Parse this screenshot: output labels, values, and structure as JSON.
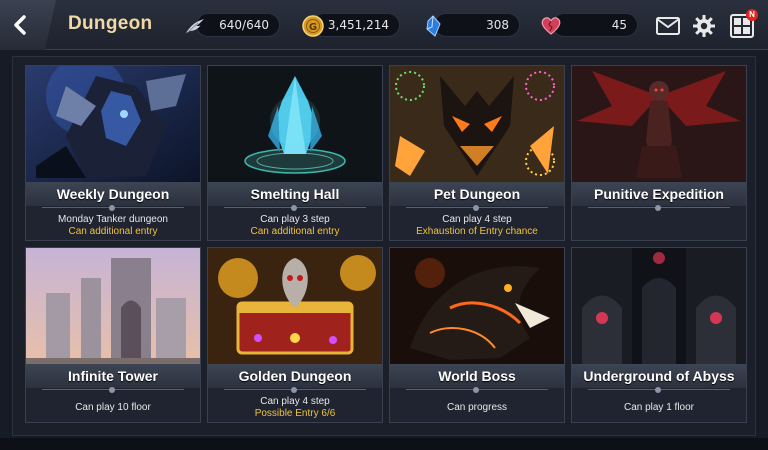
{
  "header": {
    "title": "Dungeon",
    "resources": {
      "stamina": {
        "icon": "wing-icon",
        "value": "640/640"
      },
      "gold": {
        "icon": "gold-coin-icon",
        "value": "3,451,214"
      },
      "gems": {
        "icon": "blue-crystal-icon",
        "value": "308"
      },
      "hearts": {
        "icon": "heart-icon",
        "value": "45"
      }
    },
    "buttons": {
      "mail": "mail-icon",
      "settings": "gear-icon",
      "menu": "grid-menu-icon"
    },
    "menu_badge": "N"
  },
  "dungeons": [
    {
      "name": "Weekly Dungeon",
      "line1": "Monday Tanker dungeon",
      "line2": "Can additional entry"
    },
    {
      "name": "Smelting Hall",
      "line1": "Can play 3 step",
      "line2": "Can additional entry"
    },
    {
      "name": "Pet Dungeon",
      "line1": "Can play 4 step",
      "line2": "Exhaustion of Entry chance"
    },
    {
      "name": "Punitive Expedition",
      "line1": "",
      "line2": ""
    },
    {
      "name": "Infinite Tower",
      "line1": "Can play 10 floor",
      "line2": ""
    },
    {
      "name": "Golden Dungeon",
      "line1": "Can play 4 step",
      "line2": "Possible Entry 6/6"
    },
    {
      "name": "World Boss",
      "line1": "Can progress",
      "line2": ""
    },
    {
      "name": "Underground of Abyss",
      "line1": "Can play 1 floor",
      "line2": ""
    }
  ],
  "colors": {
    "accent_title": "#f0d9a6",
    "highlight_text": "#f3c23a"
  }
}
